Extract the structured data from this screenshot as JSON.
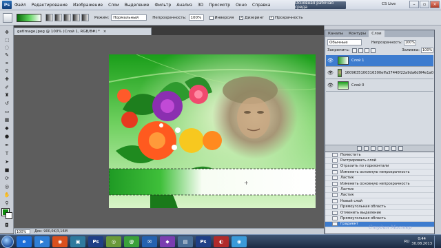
{
  "menubar": {
    "logo": "Ps",
    "items": [
      "Файл",
      "Редактирование",
      "Изображение",
      "Слои",
      "Выделение",
      "Фильтр",
      "Анализ",
      "3D",
      "Просмотр",
      "Окно",
      "Справка"
    ],
    "zoom": "100%",
    "workspace_button": "Основная рабочая среда",
    "cs_live": "CS Live"
  },
  "options": {
    "mode_label": "Режим:",
    "mode_value": "Нормальный",
    "opacity_label": "Непрозрачность:",
    "opacity_value": "100%",
    "inverse_label": "Инверсия",
    "dither_label": "Дизеринг",
    "transparency_label": "Прозрачность"
  },
  "document": {
    "tab_title": "getImage.jpeg @ 100% (Слой 1, RGB/8#) *",
    "tab_close": "×",
    "status_zoom": "100%",
    "status_doc": "Док: 900,0K/3,16M"
  },
  "layers_panel": {
    "tabs": [
      "Каналы",
      "Контуры",
      "Слои"
    ],
    "blend_mode": "Обычные",
    "opacity_label": "Непрозрачность:",
    "opacity_value": "100%",
    "lock_label": "Закрепить:",
    "fill_label": "Заливка:",
    "fill_value": "100%",
    "layers": [
      {
        "name": "Слой 1",
        "selected": true
      },
      {
        "name": "1609635100316300effa37440f22a9da6d9f4e1a0",
        "selected": false
      },
      {
        "name": "Слой 0",
        "selected": false
      }
    ]
  },
  "history": {
    "items": [
      "Поместить",
      "Растрировать слой",
      "Отразить по горизонтали",
      "Изменить основную непрозрачность",
      "Ластик",
      "Изменить основную непрозрачность",
      "Ластик",
      "Ластик",
      "Новый слой",
      "Прямоугольная область",
      "Отменить выделение",
      "Прямоугольная область",
      "Градиент"
    ]
  },
  "watermark": "Студия Мастер",
  "taskbar": {
    "apps": [
      {
        "label": "e",
        "color": "#1e6fd9"
      },
      {
        "label": "▶",
        "color": "#2f7fd6"
      },
      {
        "label": "◉",
        "color": "#d9501e"
      },
      {
        "label": "▣",
        "color": "#2f7a9e"
      },
      {
        "label": "Ps",
        "color": "#1f3f86"
      },
      {
        "label": "◎",
        "color": "#6a9a3a"
      },
      {
        "label": "@",
        "color": "#3aa13a"
      },
      {
        "label": "✉",
        "color": "#2462b0"
      },
      {
        "label": "◆",
        "color": "#7a3db0"
      },
      {
        "label": "▤",
        "color": "#4a6e96"
      },
      {
        "label": "Ps",
        "color": "#1f3f86"
      },
      {
        "label": "◐",
        "color": "#b02b2b"
      },
      {
        "label": "◉",
        "color": "#3a9ad9"
      }
    ],
    "lang": "RU",
    "time": "0:44",
    "date": "30.08.2013"
  }
}
